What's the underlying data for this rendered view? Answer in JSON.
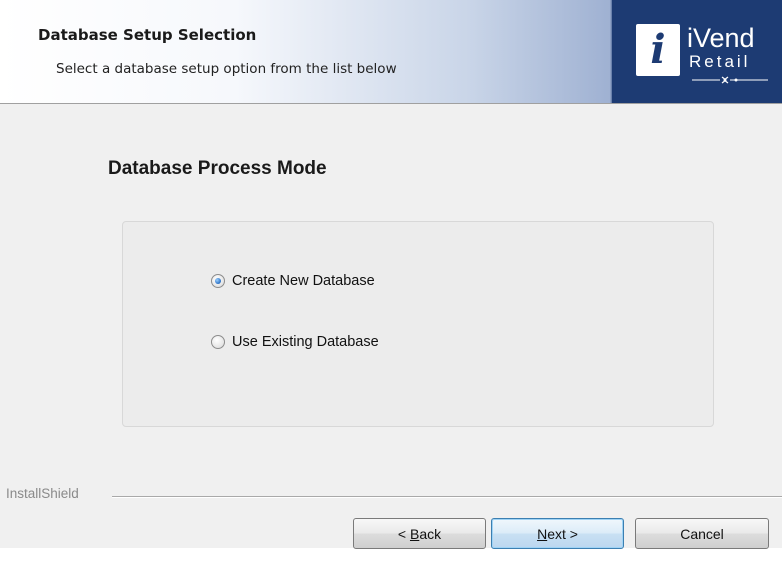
{
  "header": {
    "title": "Database Setup Selection",
    "subtitle": "Select a database setup option from the list below"
  },
  "logo": {
    "mark": "i",
    "brand": "iVend",
    "sub": "Retail"
  },
  "content": {
    "heading": "Database Process Mode",
    "options": [
      {
        "label": "Create New Database",
        "selected": true
      },
      {
        "label": "Use Existing Database",
        "selected": false
      }
    ]
  },
  "footer": {
    "installshield": "InstallShield",
    "buttons": {
      "back": {
        "prefix": "< ",
        "mnemonic": "B",
        "rest": "ack"
      },
      "next": {
        "mnemonic": "N",
        "rest": "ext >"
      },
      "cancel": {
        "label": "Cancel"
      }
    }
  },
  "colors": {
    "banner_blue": "#1d3b73",
    "radio_dot": "#2a6fc4",
    "default_button_border": "#3c7fb1"
  }
}
